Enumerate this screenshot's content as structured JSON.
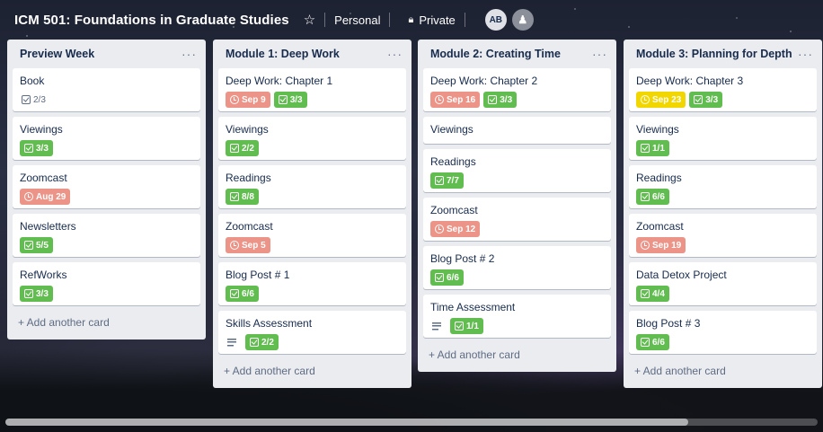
{
  "header": {
    "title": "ICM 501: Foundations in Graduate Studies",
    "star_icon": "star-icon",
    "team_label": "Personal",
    "visibility_label": "Private",
    "member_initials": "AB",
    "add_member_icon": "add-member-icon"
  },
  "lists": [
    {
      "title": "Preview Week",
      "add_label": "+ Add another card",
      "cards": [
        {
          "title": "Book",
          "badges": [
            {
              "kind": "plain-check",
              "text": "2/3"
            }
          ]
        },
        {
          "title": "Viewings",
          "badges": [
            {
              "kind": "check",
              "text": "3/3"
            }
          ]
        },
        {
          "title": "Zoomcast",
          "badges": [
            {
              "kind": "due-red",
              "text": "Aug 29"
            }
          ]
        },
        {
          "title": "Newsletters",
          "badges": [
            {
              "kind": "check",
              "text": "5/5"
            }
          ]
        },
        {
          "title": "RefWorks",
          "badges": [
            {
              "kind": "check",
              "text": "3/3"
            }
          ]
        }
      ]
    },
    {
      "title": "Module 1: Deep Work",
      "add_label": "+ Add another card",
      "cards": [
        {
          "title": "Deep Work: Chapter 1",
          "badges": [
            {
              "kind": "due-red",
              "text": "Sep 9"
            },
            {
              "kind": "check",
              "text": "3/3"
            }
          ]
        },
        {
          "title": "Viewings",
          "badges": [
            {
              "kind": "check",
              "text": "2/2"
            }
          ]
        },
        {
          "title": "Readings",
          "badges": [
            {
              "kind": "check",
              "text": "8/8"
            }
          ]
        },
        {
          "title": "Zoomcast",
          "badges": [
            {
              "kind": "due-red",
              "text": "Sep 5"
            }
          ]
        },
        {
          "title": "Blog Post # 1",
          "badges": [
            {
              "kind": "check",
              "text": "6/6"
            }
          ]
        },
        {
          "title": "Skills Assessment",
          "badges": [
            {
              "kind": "desc",
              "text": ""
            },
            {
              "kind": "check",
              "text": "2/2"
            }
          ]
        }
      ]
    },
    {
      "title": "Module 2: Creating Time",
      "add_label": "+ Add another card",
      "cards": [
        {
          "title": "Deep Work: Chapter 2",
          "badges": [
            {
              "kind": "due-red",
              "text": "Sep 16"
            },
            {
              "kind": "check",
              "text": "3/3"
            }
          ]
        },
        {
          "title": "Viewings",
          "badges": []
        },
        {
          "title": "Readings",
          "badges": [
            {
              "kind": "check",
              "text": "7/7"
            }
          ]
        },
        {
          "title": "Zoomcast",
          "badges": [
            {
              "kind": "due-red",
              "text": "Sep 12"
            }
          ]
        },
        {
          "title": "Blog Post # 2",
          "badges": [
            {
              "kind": "check",
              "text": "6/6"
            }
          ]
        },
        {
          "title": "Time Assessment",
          "badges": [
            {
              "kind": "desc",
              "text": ""
            },
            {
              "kind": "check",
              "text": "1/1"
            }
          ]
        }
      ]
    },
    {
      "title": "Module 3: Planning for Depth",
      "add_label": "+ Add another card",
      "cards": [
        {
          "title": "Deep Work: Chapter 3",
          "badges": [
            {
              "kind": "due-yellow",
              "text": "Sep 23"
            },
            {
              "kind": "check",
              "text": "3/3"
            }
          ]
        },
        {
          "title": "Viewings",
          "badges": [
            {
              "kind": "check",
              "text": "1/1"
            }
          ]
        },
        {
          "title": "Readings",
          "badges": [
            {
              "kind": "check",
              "text": "6/6"
            }
          ]
        },
        {
          "title": "Zoomcast",
          "badges": [
            {
              "kind": "due-red",
              "text": "Sep 19"
            }
          ]
        },
        {
          "title": "Data Detox Project",
          "badges": [
            {
              "kind": "check",
              "text": "4/4"
            }
          ]
        },
        {
          "title": "Blog Post # 3",
          "badges": [
            {
              "kind": "check",
              "text": "6/6"
            }
          ]
        }
      ]
    }
  ],
  "colors": {
    "green": "#61bd4f",
    "red": "#ec9488",
    "yellow": "#f2d600",
    "list_bg": "#ebecf0"
  }
}
